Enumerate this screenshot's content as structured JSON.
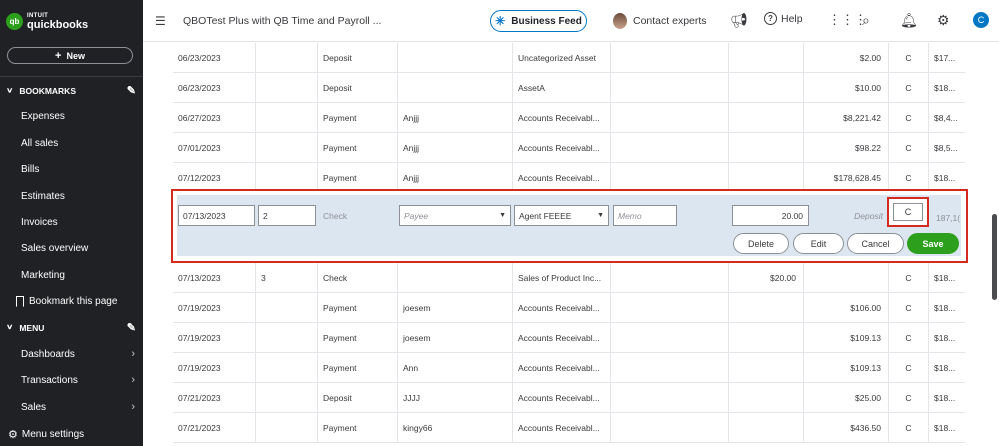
{
  "sidebar": {
    "logo_intuit": "INTUIT",
    "logo_qb": "quickbooks",
    "new_label": "New",
    "bookmarks_label": "BOOKMARKS",
    "bookmark_items": [
      "Expenses",
      "All sales",
      "Bills",
      "Estimates",
      "Invoices",
      "Sales overview",
      "Marketing"
    ],
    "bookmark_this_page": "Bookmark this page",
    "menu_label": "MENU",
    "menu_items": [
      "Dashboards",
      "Transactions",
      "Sales"
    ],
    "menu_settings": "Menu settings"
  },
  "topbar": {
    "company": "QBOTest Plus with QB Time and Payroll ...",
    "business_feed": "Business Feed",
    "contact_experts": "Contact experts",
    "help": "Help",
    "user_initial": "C"
  },
  "rows_before": [
    {
      "date": "06/23/2023",
      "num": "",
      "type": "Deposit",
      "payee": "",
      "account": "Uncategorized Asset",
      "memo": "",
      "payment": "",
      "deposit": "$2.00",
      "rec": "C",
      "balance": "$17..."
    },
    {
      "date": "06/23/2023",
      "num": "",
      "type": "Deposit",
      "payee": "",
      "account": "AssetA",
      "memo": "",
      "payment": "",
      "deposit": "$10.00",
      "rec": "C",
      "balance": "$18..."
    },
    {
      "date": "06/27/2023",
      "num": "",
      "type": "Payment",
      "payee": "Anjjj",
      "account": "Accounts Receivabl...",
      "memo": "",
      "payment": "",
      "deposit": "$8,221.42",
      "rec": "C",
      "balance": "$8,4..."
    },
    {
      "date": "07/01/2023",
      "num": "",
      "type": "Payment",
      "payee": "Anjjj",
      "account": "Accounts Receivabl...",
      "memo": "",
      "payment": "",
      "deposit": "$98.22",
      "rec": "C",
      "balance": "$8,5..."
    },
    {
      "date": "07/12/2023",
      "num": "",
      "type": "Payment",
      "payee": "Anjjj",
      "account": "Accounts Receivabl...",
      "memo": "",
      "payment": "",
      "deposit": "$178,628.45",
      "rec": "C",
      "balance": "$18..."
    }
  ],
  "edit_row": {
    "date": "07/13/2023",
    "num": "2",
    "type": "Check",
    "payee_placeholder": "Payee",
    "account": "Agent FEEEE",
    "memo_placeholder": "Memo",
    "payment": "20.00",
    "deposit_placeholder": "Deposit",
    "rec": "C",
    "balance": "187,1(",
    "buttons": {
      "delete": "Delete",
      "edit": "Edit",
      "cancel": "Cancel",
      "save": "Save"
    }
  },
  "rows_after": [
    {
      "date": "07/13/2023",
      "num": "3",
      "type": "Check",
      "payee": "",
      "account": "Sales of Product Inc...",
      "memo": "",
      "payment": "$20.00",
      "deposit": "",
      "rec": "C",
      "balance": "$18..."
    },
    {
      "date": "07/19/2023",
      "num": "",
      "type": "Payment",
      "payee": "joesem",
      "account": "Accounts Receivabl...",
      "memo": "",
      "payment": "",
      "deposit": "$106.00",
      "rec": "C",
      "balance": "$18..."
    },
    {
      "date": "07/19/2023",
      "num": "",
      "type": "Payment",
      "payee": "joesem",
      "account": "Accounts Receivabl...",
      "memo": "",
      "payment": "",
      "deposit": "$109.13",
      "rec": "C",
      "balance": "$18..."
    },
    {
      "date": "07/19/2023",
      "num": "",
      "type": "Payment",
      "payee": "Ann",
      "account": "Accounts Receivabl...",
      "memo": "",
      "payment": "",
      "deposit": "$109.13",
      "rec": "C",
      "balance": "$18..."
    },
    {
      "date": "07/21/2023",
      "num": "",
      "type": "Deposit",
      "payee": "JJJJ",
      "account": "Accounts Receivabl...",
      "memo": "",
      "payment": "",
      "deposit": "$25.00",
      "rec": "C",
      "balance": "$18..."
    },
    {
      "date": "07/21/2023",
      "num": "",
      "type": "Payment",
      "payee": "kingy66",
      "account": "Accounts Receivabl...",
      "memo": "",
      "payment": "",
      "deposit": "$436.50",
      "rec": "C",
      "balance": "$18..."
    }
  ],
  "colors": {
    "sidebar_bg": "#1f2124",
    "accent_green": "#2ca01c",
    "accent_blue": "#0077c5",
    "highlight_red": "#d52b1e",
    "edit_row_bg": "#dce6f1"
  }
}
